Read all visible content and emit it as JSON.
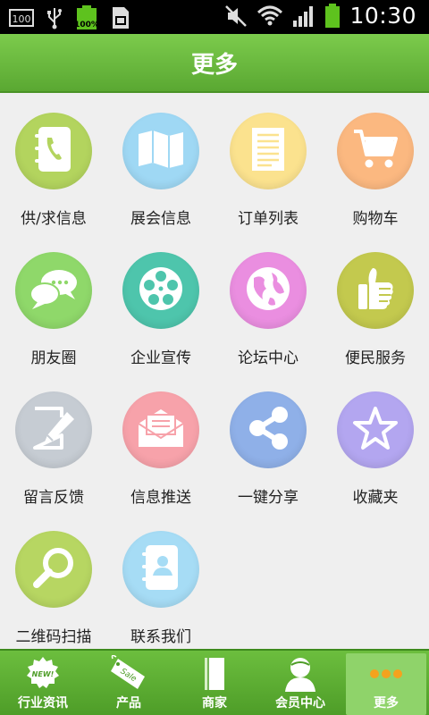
{
  "status_bar": {
    "time": "10:30",
    "left_icons": [
      "sd-card-icon",
      "usb-icon",
      "battery-full-icon",
      "sim-icon"
    ],
    "battery_small_label": "100%",
    "right_icons": [
      "muted-icon",
      "wifi-icon",
      "signal-icon",
      "battery-icon"
    ]
  },
  "header": {
    "title": "更多"
  },
  "grid": {
    "items": [
      {
        "label": "供/求信息",
        "icon": "phone-book-icon",
        "color": "#b3d45e"
      },
      {
        "label": "展会信息",
        "icon": "map-icon",
        "color": "#9fd8f4"
      },
      {
        "label": "订单列表",
        "icon": "order-list-icon",
        "color": "#fbe28e"
      },
      {
        "label": "购物车",
        "icon": "shopping-cart-icon",
        "color": "#fbb880"
      },
      {
        "label": "朋友圈",
        "icon": "chat-bubbles-icon",
        "color": "#8fd86a"
      },
      {
        "label": "企业宣传",
        "icon": "film-reel-icon",
        "color": "#4ec5ac"
      },
      {
        "label": "论坛中心",
        "icon": "globe-icon",
        "color": "#ea8ee0"
      },
      {
        "label": "便民服务",
        "icon": "thumbs-up-icon",
        "color": "#c3c94e"
      },
      {
        "label": "留言反馈",
        "icon": "edit-note-icon",
        "color": "#c6ccd3"
      },
      {
        "label": "信息推送",
        "icon": "envelope-icon",
        "color": "#f7a2aa"
      },
      {
        "label": "一键分享",
        "icon": "share-icon",
        "color": "#8fb0e8"
      },
      {
        "label": "收藏夹",
        "icon": "star-icon",
        "color": "#b3a6f0"
      },
      {
        "label": "二维码扫描",
        "icon": "magnifier-icon",
        "color": "#b7d662"
      },
      {
        "label": "联系我们",
        "icon": "contacts-icon",
        "color": "#a6dcf5"
      }
    ]
  },
  "tab_bar": {
    "tabs": [
      {
        "label": "行业资讯",
        "icon": "new-badge-icon",
        "active": false
      },
      {
        "label": "产品",
        "icon": "sale-tag-icon",
        "active": false
      },
      {
        "label": "商家",
        "icon": "book-icon",
        "active": false
      },
      {
        "label": "会员中心",
        "icon": "user-icon",
        "active": false
      },
      {
        "label": "更多",
        "icon": "more-dots-icon",
        "active": true
      }
    ],
    "new_badge_text": "NEW!",
    "sale_tag_text": "Sale"
  },
  "colors": {
    "title_bar": "#6cbe3e",
    "tab_bar": "#5aa832",
    "active_tab": "#8fd36a",
    "background": "#efefef"
  }
}
